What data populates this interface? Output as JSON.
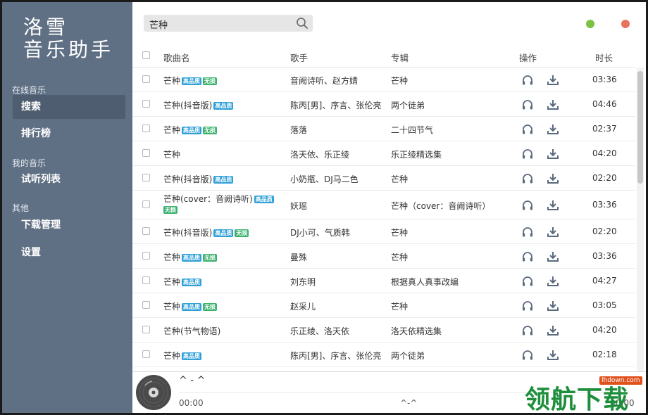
{
  "app": {
    "title_line1": "洛雪",
    "title_line2": "音乐助手"
  },
  "sidebar": {
    "sections": [
      {
        "title": "在线音乐"
      },
      {
        "title": "我的音乐"
      },
      {
        "title": "其他"
      }
    ],
    "items": [
      {
        "label": "搜索",
        "active": true
      },
      {
        "label": "排行榜",
        "active": false
      },
      {
        "label": "试听列表",
        "active": false
      },
      {
        "label": "下载管理",
        "active": false
      },
      {
        "label": "设置",
        "active": false
      }
    ]
  },
  "search": {
    "value": "芒种",
    "icon": "search-icon"
  },
  "window_controls": {
    "minimize_color": "#7cc242",
    "close_color": "#e8725a"
  },
  "table": {
    "headers": {
      "name": "歌曲名",
      "artist": "歌手",
      "album": "专辑",
      "op": "操作",
      "time": "时长"
    },
    "badges": {
      "hq": "高品质",
      "lossless": "无损"
    },
    "rows": [
      {
        "name": "芒种",
        "hq": true,
        "lossless": true,
        "artist": "音阙诗听、赵方婧",
        "album": "芒种",
        "time": "03:36"
      },
      {
        "name": "芒种(抖音版)",
        "hq": true,
        "lossless": false,
        "artist": "陈丙[男]、序言、张伦亮",
        "album": "两个徒弟",
        "time": "04:46"
      },
      {
        "name": "芒种",
        "hq": true,
        "lossless": true,
        "artist": "落落",
        "album": "二十四节气",
        "time": "02:37"
      },
      {
        "name": "芒种",
        "hq": false,
        "lossless": false,
        "artist": "洛天依、乐正绫",
        "album": "乐正绫精选集",
        "time": "04:20"
      },
      {
        "name": "芒种(抖音版)",
        "hq": true,
        "lossless": false,
        "artist": "小奶瓶、DJ马二色",
        "album": "芒种",
        "time": "02:20"
      },
      {
        "name": "芒种(cover：音阙诗听)",
        "hq": true,
        "lossless": true,
        "artist": "妖瑶",
        "album": "芒种（cover：音阙诗听）",
        "time": "03:36",
        "wrap": true
      },
      {
        "name": "芒种(抖音版)",
        "hq": true,
        "lossless": true,
        "artist": "DJ小可、气质韩",
        "album": "芒种",
        "time": "02:20"
      },
      {
        "name": "芒种",
        "hq": true,
        "lossless": true,
        "artist": "曼殊",
        "album": "芒种",
        "time": "03:36"
      },
      {
        "name": "芒种",
        "hq": true,
        "lossless": false,
        "artist": "刘东明",
        "album": "根据真人真事改编",
        "time": "04:27"
      },
      {
        "name": "芒种",
        "hq": true,
        "lossless": true,
        "artist": "赵采儿",
        "album": "芒种",
        "time": "03:05"
      },
      {
        "name": "芒种(节气物语)",
        "hq": false,
        "lossless": false,
        "artist": "乐正绫、洛天依",
        "album": "洛天依精选集",
        "time": "04:20"
      },
      {
        "name": "芒种",
        "hq": true,
        "lossless": false,
        "artist": "陈丙[男]、序言、张伦亮",
        "album": "两个徒弟",
        "time": "02:18"
      }
    ]
  },
  "player": {
    "title": "^ - ^",
    "time_current": "00:00",
    "center_text": "^-^",
    "time_total": "00:00"
  },
  "watermark": {
    "text": "领航下载",
    "url": "lhdown.com"
  }
}
